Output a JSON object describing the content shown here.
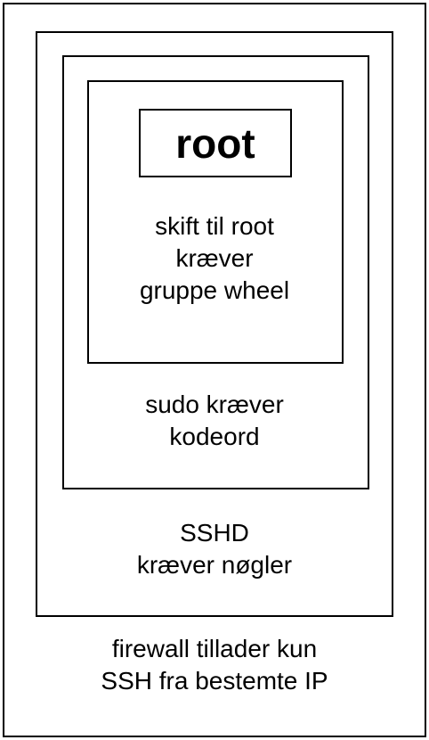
{
  "diagram": {
    "core": {
      "label": "root"
    },
    "layers": [
      {
        "id": "wheel",
        "lines": [
          "skift til root",
          "kræver",
          "gruppe wheel"
        ]
      },
      {
        "id": "sudo",
        "lines": [
          "sudo kræver",
          "kodeord"
        ]
      },
      {
        "id": "sshd",
        "lines": [
          "SSHD",
          "kræver nøgler"
        ]
      },
      {
        "id": "firewall",
        "lines": [
          "firewall tillader kun",
          "SSH fra bestemte IP"
        ]
      }
    ]
  }
}
